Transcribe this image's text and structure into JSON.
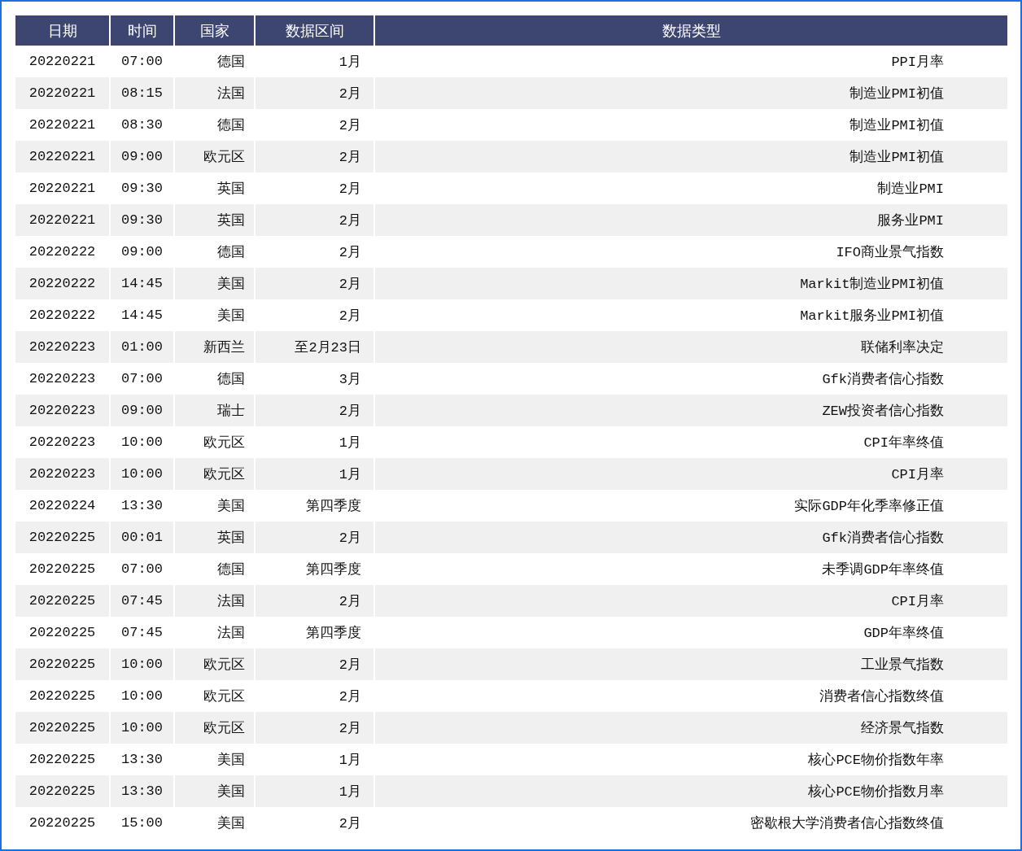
{
  "table": {
    "columns": [
      "日期",
      "时间",
      "国家",
      "数据区间",
      "数据类型"
    ],
    "rows": [
      [
        "20220221",
        "07:00",
        "德国",
        "1月",
        "PPI月率"
      ],
      [
        "20220221",
        "08:15",
        "法国",
        "2月",
        "制造业PMI初值"
      ],
      [
        "20220221",
        "08:30",
        "德国",
        "2月",
        "制造业PMI初值"
      ],
      [
        "20220221",
        "09:00",
        "欧元区",
        "2月",
        "制造业PMI初值"
      ],
      [
        "20220221",
        "09:30",
        "英国",
        "2月",
        "制造业PMI"
      ],
      [
        "20220221",
        "09:30",
        "英国",
        "2月",
        "服务业PMI"
      ],
      [
        "20220222",
        "09:00",
        "德国",
        "2月",
        "IFO商业景气指数"
      ],
      [
        "20220222",
        "14:45",
        "美国",
        "2月",
        "Markit制造业PMI初值"
      ],
      [
        "20220222",
        "14:45",
        "美国",
        "2月",
        "Markit服务业PMI初值"
      ],
      [
        "20220223",
        "01:00",
        "新西兰",
        "至2月23日",
        "联储利率决定"
      ],
      [
        "20220223",
        "07:00",
        "德国",
        "3月",
        "Gfk消费者信心指数"
      ],
      [
        "20220223",
        "09:00",
        "瑞士",
        "2月",
        "ZEW投资者信心指数"
      ],
      [
        "20220223",
        "10:00",
        "欧元区",
        "1月",
        "CPI年率终值"
      ],
      [
        "20220223",
        "10:00",
        "欧元区",
        "1月",
        "CPI月率"
      ],
      [
        "20220224",
        "13:30",
        "美国",
        "第四季度",
        "实际GDP年化季率修正值"
      ],
      [
        "20220225",
        "00:01",
        "英国",
        "2月",
        "Gfk消费者信心指数"
      ],
      [
        "20220225",
        "07:00",
        "德国",
        "第四季度",
        "未季调GDP年率终值"
      ],
      [
        "20220225",
        "07:45",
        "法国",
        "2月",
        "CPI月率"
      ],
      [
        "20220225",
        "07:45",
        "法国",
        "第四季度",
        "GDP年率终值"
      ],
      [
        "20220225",
        "10:00",
        "欧元区",
        "2月",
        "工业景气指数"
      ],
      [
        "20220225",
        "10:00",
        "欧元区",
        "2月",
        "消费者信心指数终值"
      ],
      [
        "20220225",
        "10:00",
        "欧元区",
        "2月",
        "经济景气指数"
      ],
      [
        "20220225",
        "13:30",
        "美国",
        "1月",
        "核心PCE物价指数年率"
      ],
      [
        "20220225",
        "13:30",
        "美国",
        "1月",
        "核心PCE物价指数月率"
      ],
      [
        "20220225",
        "15:00",
        "美国",
        "2月",
        "密歇根大学消费者信心指数终值"
      ]
    ]
  }
}
